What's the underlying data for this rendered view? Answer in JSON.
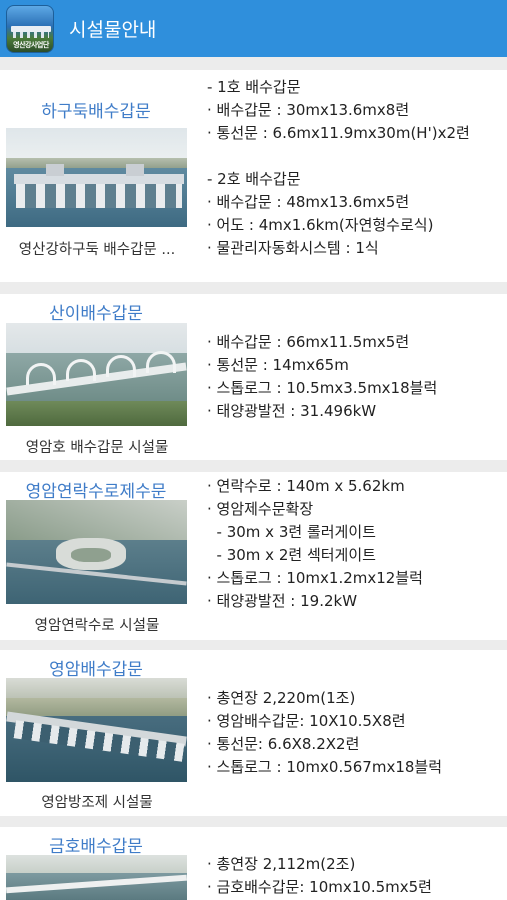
{
  "app": {
    "title": "시설물안내",
    "logo_text": "영산강사업단"
  },
  "facilities": [
    {
      "name": "하구둑배수갑문",
      "caption": "영산강하구둑 배수갑문 ...",
      "specs": [
        "- 1호 배수갑문",
        "· 배수갑문 : 30mx13.6mx8련",
        "· 통선문 : 6.6mx11.9mx30m(H')x2련",
        "",
        "- 2호 배수갑문",
        "· 배수갑문 : 48mx13.6mx5련",
        "· 어도 : 4mx1.6km(자연형수로식)",
        "· 물관리자동화시스템 : 1식"
      ]
    },
    {
      "name": "산이배수갑문",
      "caption": "영암호 배수갑문 시설물",
      "specs": [
        "· 배수갑문 : 66mx11.5mx5련",
        "· 통선문 : 14mx65m",
        "· 스톱로그 : 10.5mx3.5mx18블럭",
        "· 태양광발전 : 31.496kW"
      ]
    },
    {
      "name": "영암연락수로제수문",
      "caption": "영암연락수로 시설물",
      "specs": [
        "· 연락수로 : 140m x 5.62km",
        "· 영암제수문확장",
        "  - 30m x 3련 롤러게이트",
        "  - 30m x 2련 섹터게이트",
        "· 스톱로그 : 10mx1.2mx12블럭",
        "· 태양광발전 : 19.2kW"
      ]
    },
    {
      "name": "영암배수갑문",
      "caption": "영암방조제 시설물",
      "specs": [
        "· 총연장 2,220m(1조)",
        "· 영암배수갑문: 10X10.5X8련",
        "· 통선문: 6.6X8.2X2련",
        "· 스톱로그 : 10mx0.567mx18블럭"
      ]
    },
    {
      "name": "금호배수갑문",
      "caption": "",
      "specs": [
        "· 총연장 2,112m(2조)",
        "· 금호배수갑문: 10mx10.5mx5련"
      ]
    }
  ]
}
